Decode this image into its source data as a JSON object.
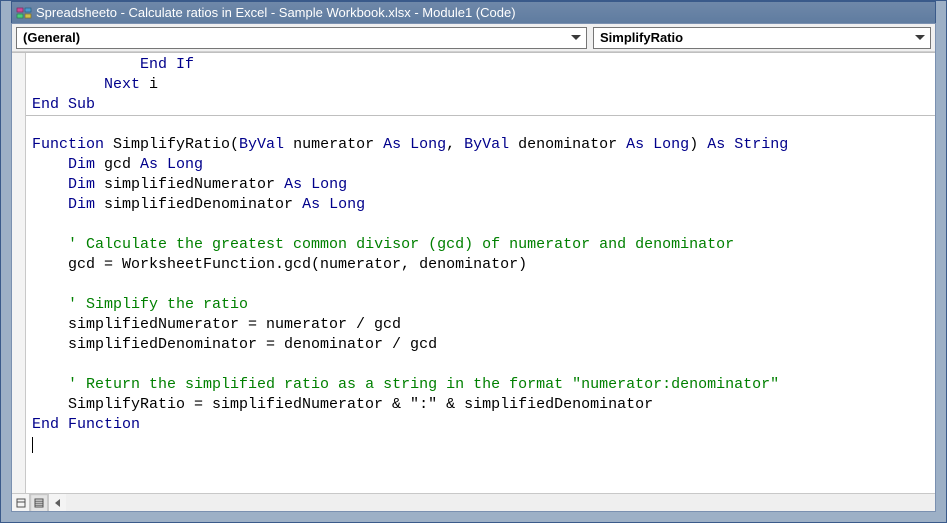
{
  "window": {
    "title": "Spreadsheeto - Calculate ratios in Excel - Sample Workbook.xlsx - Module1 (Code)"
  },
  "dropdowns": {
    "object": "(General)",
    "procedure": "SimplifyRatio"
  },
  "code": {
    "lines": [
      [
        [
          "",
          "            "
        ],
        [
          "kw",
          "End If"
        ]
      ],
      [
        [
          "",
          "        "
        ],
        [
          "kw",
          "Next"
        ],
        [
          "",
          " i"
        ]
      ],
      [
        [
          "kw",
          "End Sub"
        ]
      ],
      [
        [
          "",
          ""
        ]
      ],
      [
        [
          "kw",
          "Function"
        ],
        [
          "",
          " SimplifyRatio("
        ],
        [
          "kw",
          "ByVal"
        ],
        [
          "",
          " numerator "
        ],
        [
          "kw",
          "As Long"
        ],
        [
          "",
          ", "
        ],
        [
          "kw",
          "ByVal"
        ],
        [
          "",
          " denominator "
        ],
        [
          "kw",
          "As Long"
        ],
        [
          "",
          ") "
        ],
        [
          "kw",
          "As String"
        ]
      ],
      [
        [
          "",
          "    "
        ],
        [
          "kw",
          "Dim"
        ],
        [
          "",
          " gcd "
        ],
        [
          "kw",
          "As Long"
        ]
      ],
      [
        [
          "",
          "    "
        ],
        [
          "kw",
          "Dim"
        ],
        [
          "",
          " simplifiedNumerator "
        ],
        [
          "kw",
          "As Long"
        ]
      ],
      [
        [
          "",
          "    "
        ],
        [
          "kw",
          "Dim"
        ],
        [
          "",
          " simplifiedDenominator "
        ],
        [
          "kw",
          "As Long"
        ]
      ],
      [
        [
          "",
          ""
        ]
      ],
      [
        [
          "",
          "    "
        ],
        [
          "cm",
          "' Calculate the greatest common divisor (gcd) of numerator and denominator"
        ]
      ],
      [
        [
          "",
          "    gcd = WorksheetFunction.gcd(numerator, denominator)"
        ]
      ],
      [
        [
          "",
          ""
        ]
      ],
      [
        [
          "",
          "    "
        ],
        [
          "cm",
          "' Simplify the ratio"
        ]
      ],
      [
        [
          "",
          "    simplifiedNumerator = numerator / gcd"
        ]
      ],
      [
        [
          "",
          "    simplifiedDenominator = denominator / gcd"
        ]
      ],
      [
        [
          "",
          ""
        ]
      ],
      [
        [
          "",
          "    "
        ],
        [
          "cm",
          "' Return the simplified ratio as a string in the format \"numerator:denominator\""
        ]
      ],
      [
        [
          "",
          "    SimplifyRatio = simplifiedNumerator & \":\" & simplifiedDenominator"
        ]
      ],
      [
        [
          "kw",
          "End Function"
        ]
      ]
    ],
    "separator_after_index": 2
  }
}
